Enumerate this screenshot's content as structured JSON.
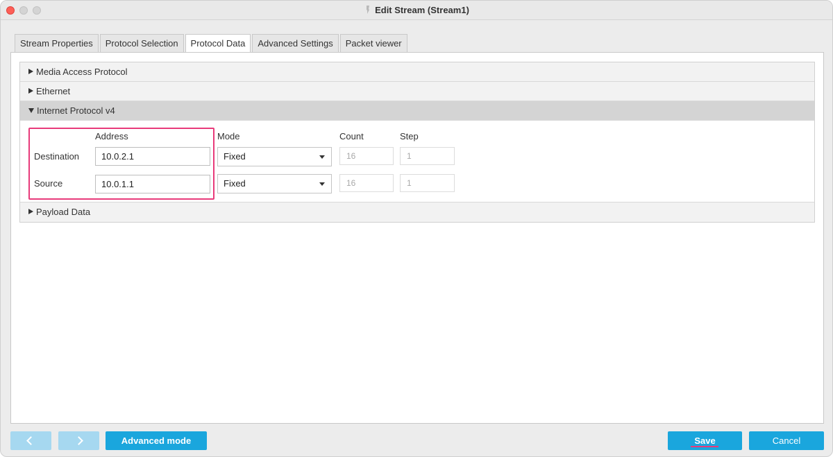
{
  "window": {
    "title": "Edit Stream (Stream1)"
  },
  "tabs": [
    {
      "label": "Stream Properties",
      "active": false
    },
    {
      "label": "Protocol Selection",
      "active": false
    },
    {
      "label": "Protocol Data",
      "active": true
    },
    {
      "label": "Advanced Settings",
      "active": false
    },
    {
      "label": "Packet viewer",
      "active": false
    }
  ],
  "sections": {
    "mac": {
      "label": "Media Access Protocol",
      "expanded": false
    },
    "ethernet": {
      "label": "Ethernet",
      "expanded": false
    },
    "ipv4": {
      "label": "Internet Protocol v4",
      "expanded": true
    },
    "payload": {
      "label": "Payload Data",
      "expanded": false
    }
  },
  "ipv4": {
    "columns": {
      "address": "Address",
      "mode": "Mode",
      "count": "Count",
      "step": "Step"
    },
    "rows": {
      "destination": {
        "label": "Destination",
        "address": "10.0.2.1",
        "mode": "Fixed",
        "count": "16",
        "step": "1"
      },
      "source": {
        "label": "Source",
        "address": "10.0.1.1",
        "mode": "Fixed",
        "count": "16",
        "step": "1"
      }
    }
  },
  "footer": {
    "advanced_mode": "Advanced mode",
    "save": "Save",
    "cancel": "Cancel"
  },
  "colors": {
    "accent": "#1aa6dd",
    "highlight": "#e83a7a",
    "nav_disabled": "#a6d8f0"
  }
}
